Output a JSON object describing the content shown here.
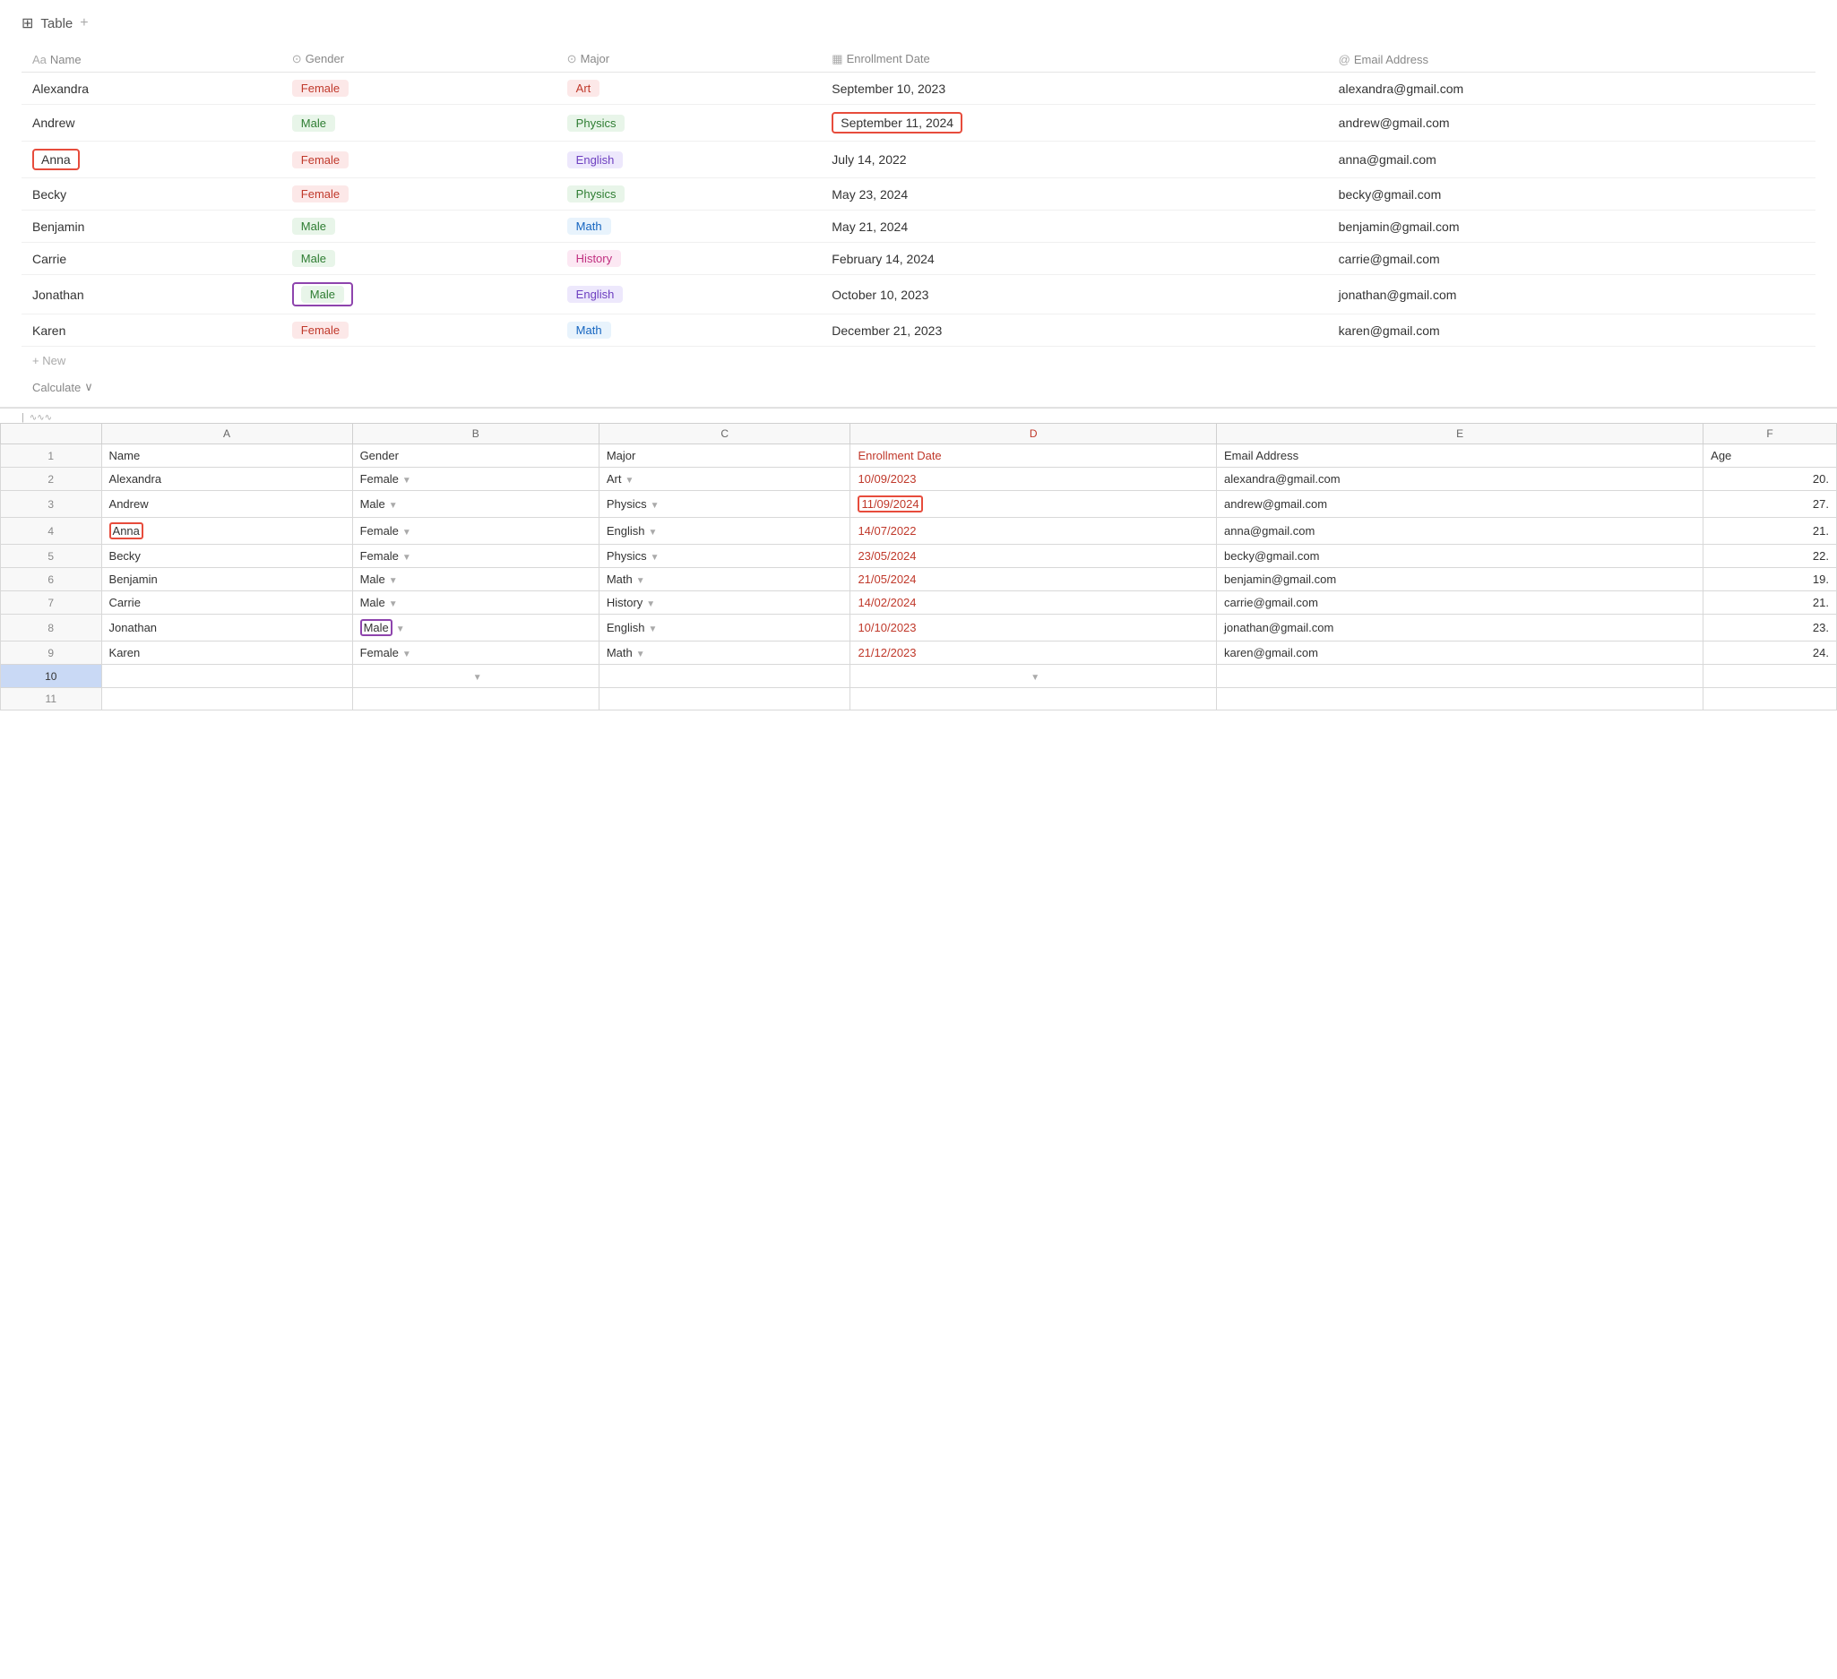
{
  "title": {
    "label": "Table",
    "plus": "+",
    "icon": "⊞"
  },
  "notion_table": {
    "columns": [
      {
        "icon": "Aa",
        "label": "Name"
      },
      {
        "icon": "⊙",
        "label": "Gender"
      },
      {
        "icon": "⊙",
        "label": "Major"
      },
      {
        "icon": "▦",
        "label": "Enrollment Date"
      },
      {
        "icon": "@",
        "label": "Email Address"
      }
    ],
    "rows": [
      {
        "name": "Alexandra",
        "gender": "Female",
        "gender_class": "tag-female",
        "major": "Art",
        "major_class": "tag-art",
        "date": "September 10, 2023",
        "email": "alexandra@gmail.com",
        "name_highlight": "",
        "gender_highlight": "",
        "date_highlight": ""
      },
      {
        "name": "Andrew",
        "gender": "Male",
        "gender_class": "tag-male",
        "major": "Physics",
        "major_class": "tag-physics",
        "date": "September 11, 2024",
        "email": "andrew@gmail.com",
        "name_highlight": "",
        "gender_highlight": "",
        "date_highlight": "red"
      },
      {
        "name": "Anna",
        "gender": "Female",
        "gender_class": "tag-female",
        "major": "English",
        "major_class": "tag-english",
        "date": "July 14, 2022",
        "email": "anna@gmail.com",
        "name_highlight": "red",
        "gender_highlight": "",
        "date_highlight": ""
      },
      {
        "name": "Becky",
        "gender": "Female",
        "gender_class": "tag-female",
        "major": "Physics",
        "major_class": "tag-physics",
        "date": "May 23, 2024",
        "email": "becky@gmail.com",
        "name_highlight": "",
        "gender_highlight": "",
        "date_highlight": ""
      },
      {
        "name": "Benjamin",
        "gender": "Male",
        "gender_class": "tag-male",
        "major": "Math",
        "major_class": "tag-math",
        "date": "May 21, 2024",
        "email": "benjamin@gmail.com",
        "name_highlight": "",
        "gender_highlight": "",
        "date_highlight": ""
      },
      {
        "name": "Carrie",
        "gender": "Male",
        "gender_class": "tag-male",
        "major": "History",
        "major_class": "tag-history",
        "date": "February 14, 2024",
        "email": "carrie@gmail.com",
        "name_highlight": "",
        "gender_highlight": "",
        "date_highlight": ""
      },
      {
        "name": "Jonathan",
        "gender": "Male",
        "gender_class": "tag-male",
        "major": "English",
        "major_class": "tag-english",
        "date": "October 10, 2023",
        "email": "jonathan@gmail.com",
        "name_highlight": "",
        "gender_highlight": "purple",
        "date_highlight": ""
      },
      {
        "name": "Karen",
        "gender": "Female",
        "gender_class": "tag-female",
        "major": "Math",
        "major_class": "tag-math",
        "date": "December 21, 2023",
        "email": "karen@gmail.com",
        "name_highlight": "",
        "gender_highlight": "",
        "date_highlight": ""
      }
    ],
    "new_label": "+ New",
    "calculate_label": "Calculate"
  },
  "spreadsheet": {
    "col_headers": [
      "",
      "A",
      "B",
      "C",
      "D",
      "E",
      "F"
    ],
    "header_row": [
      "",
      "Name",
      "Gender",
      "Major",
      "Enrollment Date",
      "Email Address",
      "Age"
    ],
    "rows": [
      {
        "num": "2",
        "A": "Alexandra",
        "B": "Female",
        "C": "Art",
        "D": "10/09/2023",
        "E": "alexandra@gmail.com",
        "F": "20.",
        "num_selected": false,
        "D_highlight": false,
        "A_highlight": false,
        "B_highlight": false
      },
      {
        "num": "3",
        "A": "Andrew",
        "B": "Male",
        "C": "Physics",
        "D": "11/09/2024",
        "E": "andrew@gmail.com",
        "F": "27.",
        "num_selected": false,
        "D_highlight": true,
        "A_highlight": false,
        "B_highlight": false
      },
      {
        "num": "4",
        "A": "Anna",
        "B": "Female",
        "C": "English",
        "D": "14/07/2022",
        "E": "anna@gmail.com",
        "F": "21.",
        "num_selected": false,
        "D_highlight": false,
        "A_highlight": true,
        "B_highlight": false
      },
      {
        "num": "5",
        "A": "Becky",
        "B": "Female",
        "C": "Physics",
        "D": "23/05/2024",
        "E": "becky@gmail.com",
        "F": "22.",
        "num_selected": false,
        "D_highlight": false,
        "A_highlight": false,
        "B_highlight": false
      },
      {
        "num": "6",
        "A": "Benjamin",
        "B": "Male",
        "C": "Math",
        "D": "21/05/2024",
        "E": "benjamin@gmail.com",
        "F": "19.",
        "num_selected": false,
        "D_highlight": false,
        "A_highlight": false,
        "B_highlight": false
      },
      {
        "num": "7",
        "A": "Carrie",
        "B": "Male",
        "C": "History",
        "D": "14/02/2024",
        "E": "carrie@gmail.com",
        "F": "21.",
        "num_selected": false,
        "D_highlight": false,
        "A_highlight": false,
        "B_highlight": false
      },
      {
        "num": "8",
        "A": "Jonathan",
        "B": "Male",
        "C": "English",
        "D": "10/10/2023",
        "E": "jonathan@gmail.com",
        "F": "23.",
        "num_selected": false,
        "D_highlight": false,
        "A_highlight": false,
        "B_highlight": true
      },
      {
        "num": "9",
        "A": "Karen",
        "B": "Female",
        "C": "Math",
        "D": "21/12/2023",
        "E": "karen@gmail.com",
        "F": "24.",
        "num_selected": false,
        "D_highlight": false,
        "A_highlight": false,
        "B_highlight": false
      }
    ],
    "empty_row_num": "10",
    "extra_row_num": "11"
  }
}
